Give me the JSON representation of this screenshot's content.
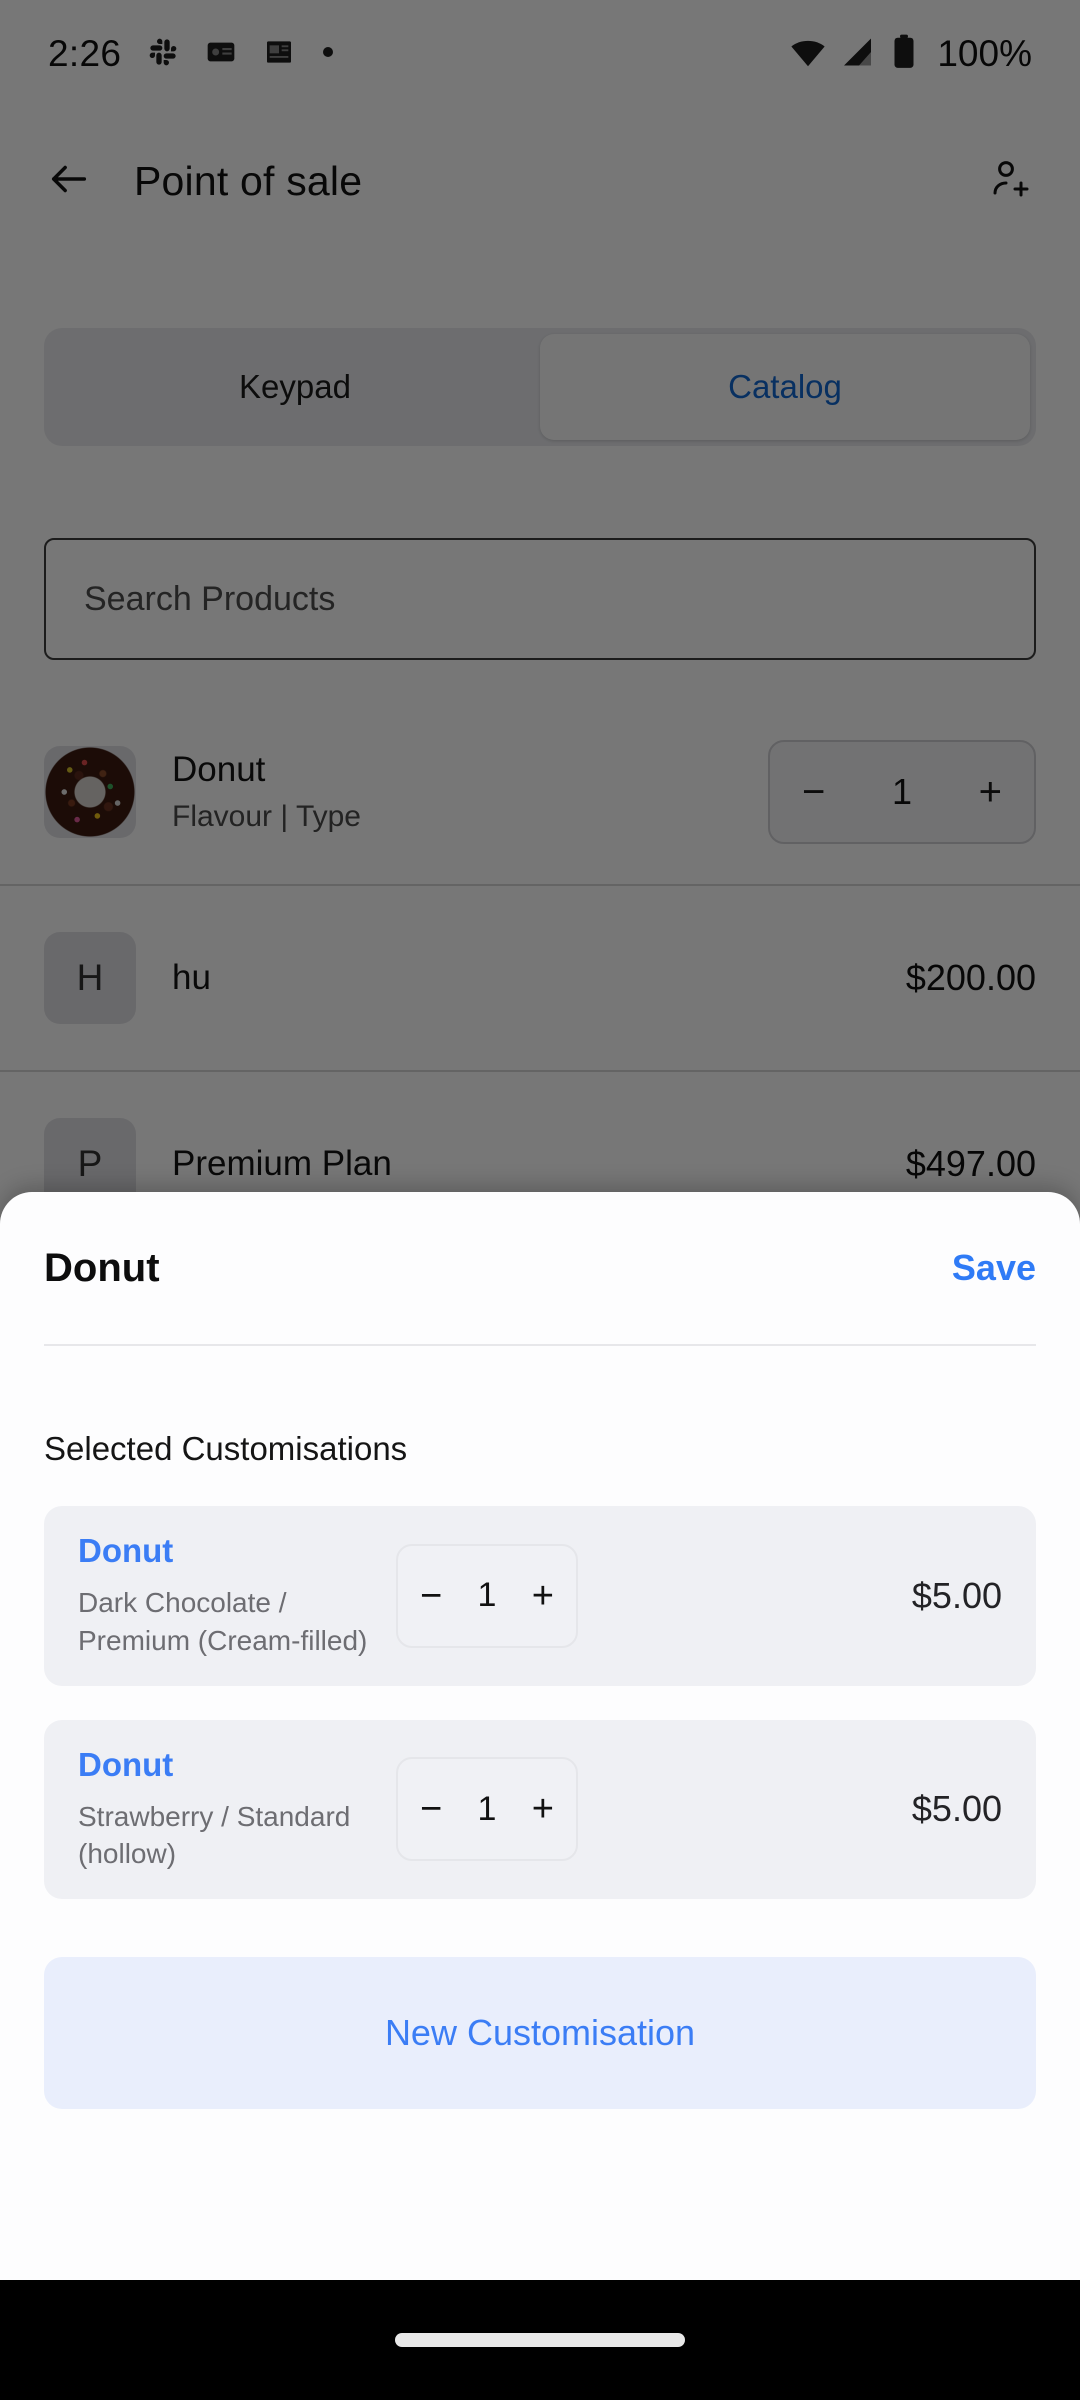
{
  "status_bar": {
    "time": "2:26",
    "left_icons": [
      "slack-icon",
      "gmail-icon",
      "news-icon",
      "dot-icon"
    ],
    "right_icons": [
      "wifi-icon",
      "cellular-signal-icon",
      "battery-icon"
    ],
    "battery": "100%"
  },
  "app_bar": {
    "back_icon": "back-arrow-icon",
    "title": "Point of sale",
    "action_icon": "add-person-icon"
  },
  "tabs": [
    {
      "label": "Keypad",
      "selected": false
    },
    {
      "label": "Catalog",
      "selected": true
    }
  ],
  "search": {
    "placeholder": "Search Products",
    "value": ""
  },
  "catalog": [
    {
      "thumb_type": "image",
      "thumb_letter": "",
      "name": "Donut",
      "subtitle": "Flavour | Type",
      "price": "",
      "stepper": {
        "minus": "−",
        "value": "1",
        "plus": "+"
      }
    },
    {
      "thumb_type": "letter",
      "thumb_letter": "H",
      "name": "hu",
      "subtitle": "",
      "price": "$200.00",
      "stepper": null
    },
    {
      "thumb_type": "letter",
      "thumb_letter": "P",
      "name": "Premium Plan",
      "subtitle": "",
      "price": "$497.00",
      "stepper": null
    }
  ],
  "sheet": {
    "title": "Donut",
    "save_label": "Save",
    "section_label": "Selected Customisations",
    "customisations": [
      {
        "name": "Donut",
        "options": "Dark Chocolate  / Premium (Cream-filled)",
        "quantity": "1",
        "minus": "−",
        "plus": "+",
        "price": "$5.00"
      },
      {
        "name": "Donut",
        "options": "Strawberry  / Standard (hollow)",
        "quantity": "1",
        "minus": "−",
        "plus": "+",
        "price": "$5.00"
      }
    ],
    "new_customisation_label": "New Customisation"
  },
  "colors": {
    "accent_blue": "#3b7df5",
    "tab_blue": "#1268d0",
    "card_grey": "#eff0f4",
    "button_bg": "#e9eefc",
    "scrim": "rgba(0,0,0,0.535)"
  },
  "nav_bar": {
    "home_indicator": "home-indicator"
  }
}
